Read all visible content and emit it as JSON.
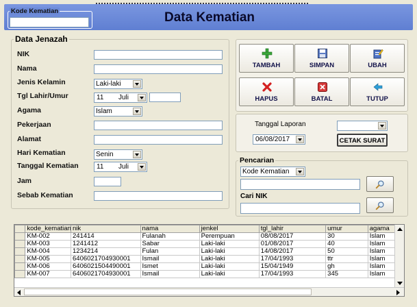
{
  "form_title": "Data Kematian",
  "kode_kematian": {
    "label": "Kode Kematian",
    "value": ""
  },
  "data_jenazah": {
    "title": "Data Jenazah",
    "nik_label": "NIK",
    "nik_value": "",
    "nama_label": "Nama",
    "nama_value": "",
    "jenis_kelamin_label": "Jenis Kelamin",
    "jenis_kelamin_value": "Laki-laki",
    "tgl_lahir_label": "Tgl Lahir/Umur",
    "tgl_lahir_day": "11",
    "tgl_lahir_month": "Juli",
    "umur_value": "",
    "agama_label": "Agama",
    "agama_value": "Islam",
    "pekerjaan_label": "Pekerjaan",
    "pekerjaan_value": "",
    "alamat_label": "Alamat",
    "alamat_value": "",
    "hari_kematian_label": "Hari Kematian",
    "hari_kematian_value": "Senin",
    "tanggal_kematian_label": "Tanggal Kematian",
    "tanggal_kematian_day": "11",
    "tanggal_kematian_month": "Juli",
    "jam_label": "Jam",
    "jam_value": "",
    "sebab_kematian_label": "Sebab Kematian",
    "sebab_kematian_value": ""
  },
  "buttons": {
    "tambah": "TAMBAH",
    "simpan": "SIMPAN",
    "ubah": "UBAH",
    "hapus": "HAPUS",
    "batal": "BATAL",
    "tutup": "TUTUP"
  },
  "laporan": {
    "label": "Tanggal Laporan",
    "date_value": "06/08/2017",
    "combo_value": "",
    "cetak_label": "CETAK SURAT"
  },
  "pencarian": {
    "title": "Pencarian",
    "mode_value": "Kode Kematian",
    "search_value": "",
    "cari_nik_label": "Cari NIK",
    "nik_value": ""
  },
  "grid": {
    "columns": [
      "kode_kematian",
      "nik",
      "nama",
      "jenkel",
      "tgl_lahir",
      "umur",
      "agama"
    ],
    "rows": [
      [
        "KM-002",
        "241414",
        "Fulanah",
        "Perempuan",
        "08/08/2017",
        "30",
        "Islam"
      ],
      [
        "KM-003",
        "1241412",
        "Sabar",
        "Laki-laki",
        "01/08/2017",
        "40",
        "Islam"
      ],
      [
        "KM-004",
        "1234214",
        "Fulan",
        "Laki-laki",
        "14/08/2017",
        "50",
        "Islam"
      ],
      [
        "KM-005",
        "6406021704930001",
        "Ismail",
        "Laki-laki",
        "17/04/1993",
        "ttr",
        "Islam"
      ],
      [
        "KM-006",
        "6406021504490001",
        "Ismet",
        "Laki-laki",
        "15/04/1949",
        "gh",
        "Islam"
      ],
      [
        "KM-007",
        "6406021704930001",
        "Ismail",
        "Laki-laki",
        "17/04/1993",
        "345",
        "Islam"
      ]
    ]
  },
  "colors": {
    "title_bar": "#6c8ad8",
    "panel": "#ece9d8",
    "input_border": "#7f9db9"
  },
  "icons": {
    "tambah": "plus-icon",
    "simpan": "save-icon",
    "ubah": "edit-icon",
    "hapus": "delete-icon",
    "batal": "cancel-icon",
    "tutup": "close-arrow-icon",
    "search": "magnifier-icon"
  }
}
